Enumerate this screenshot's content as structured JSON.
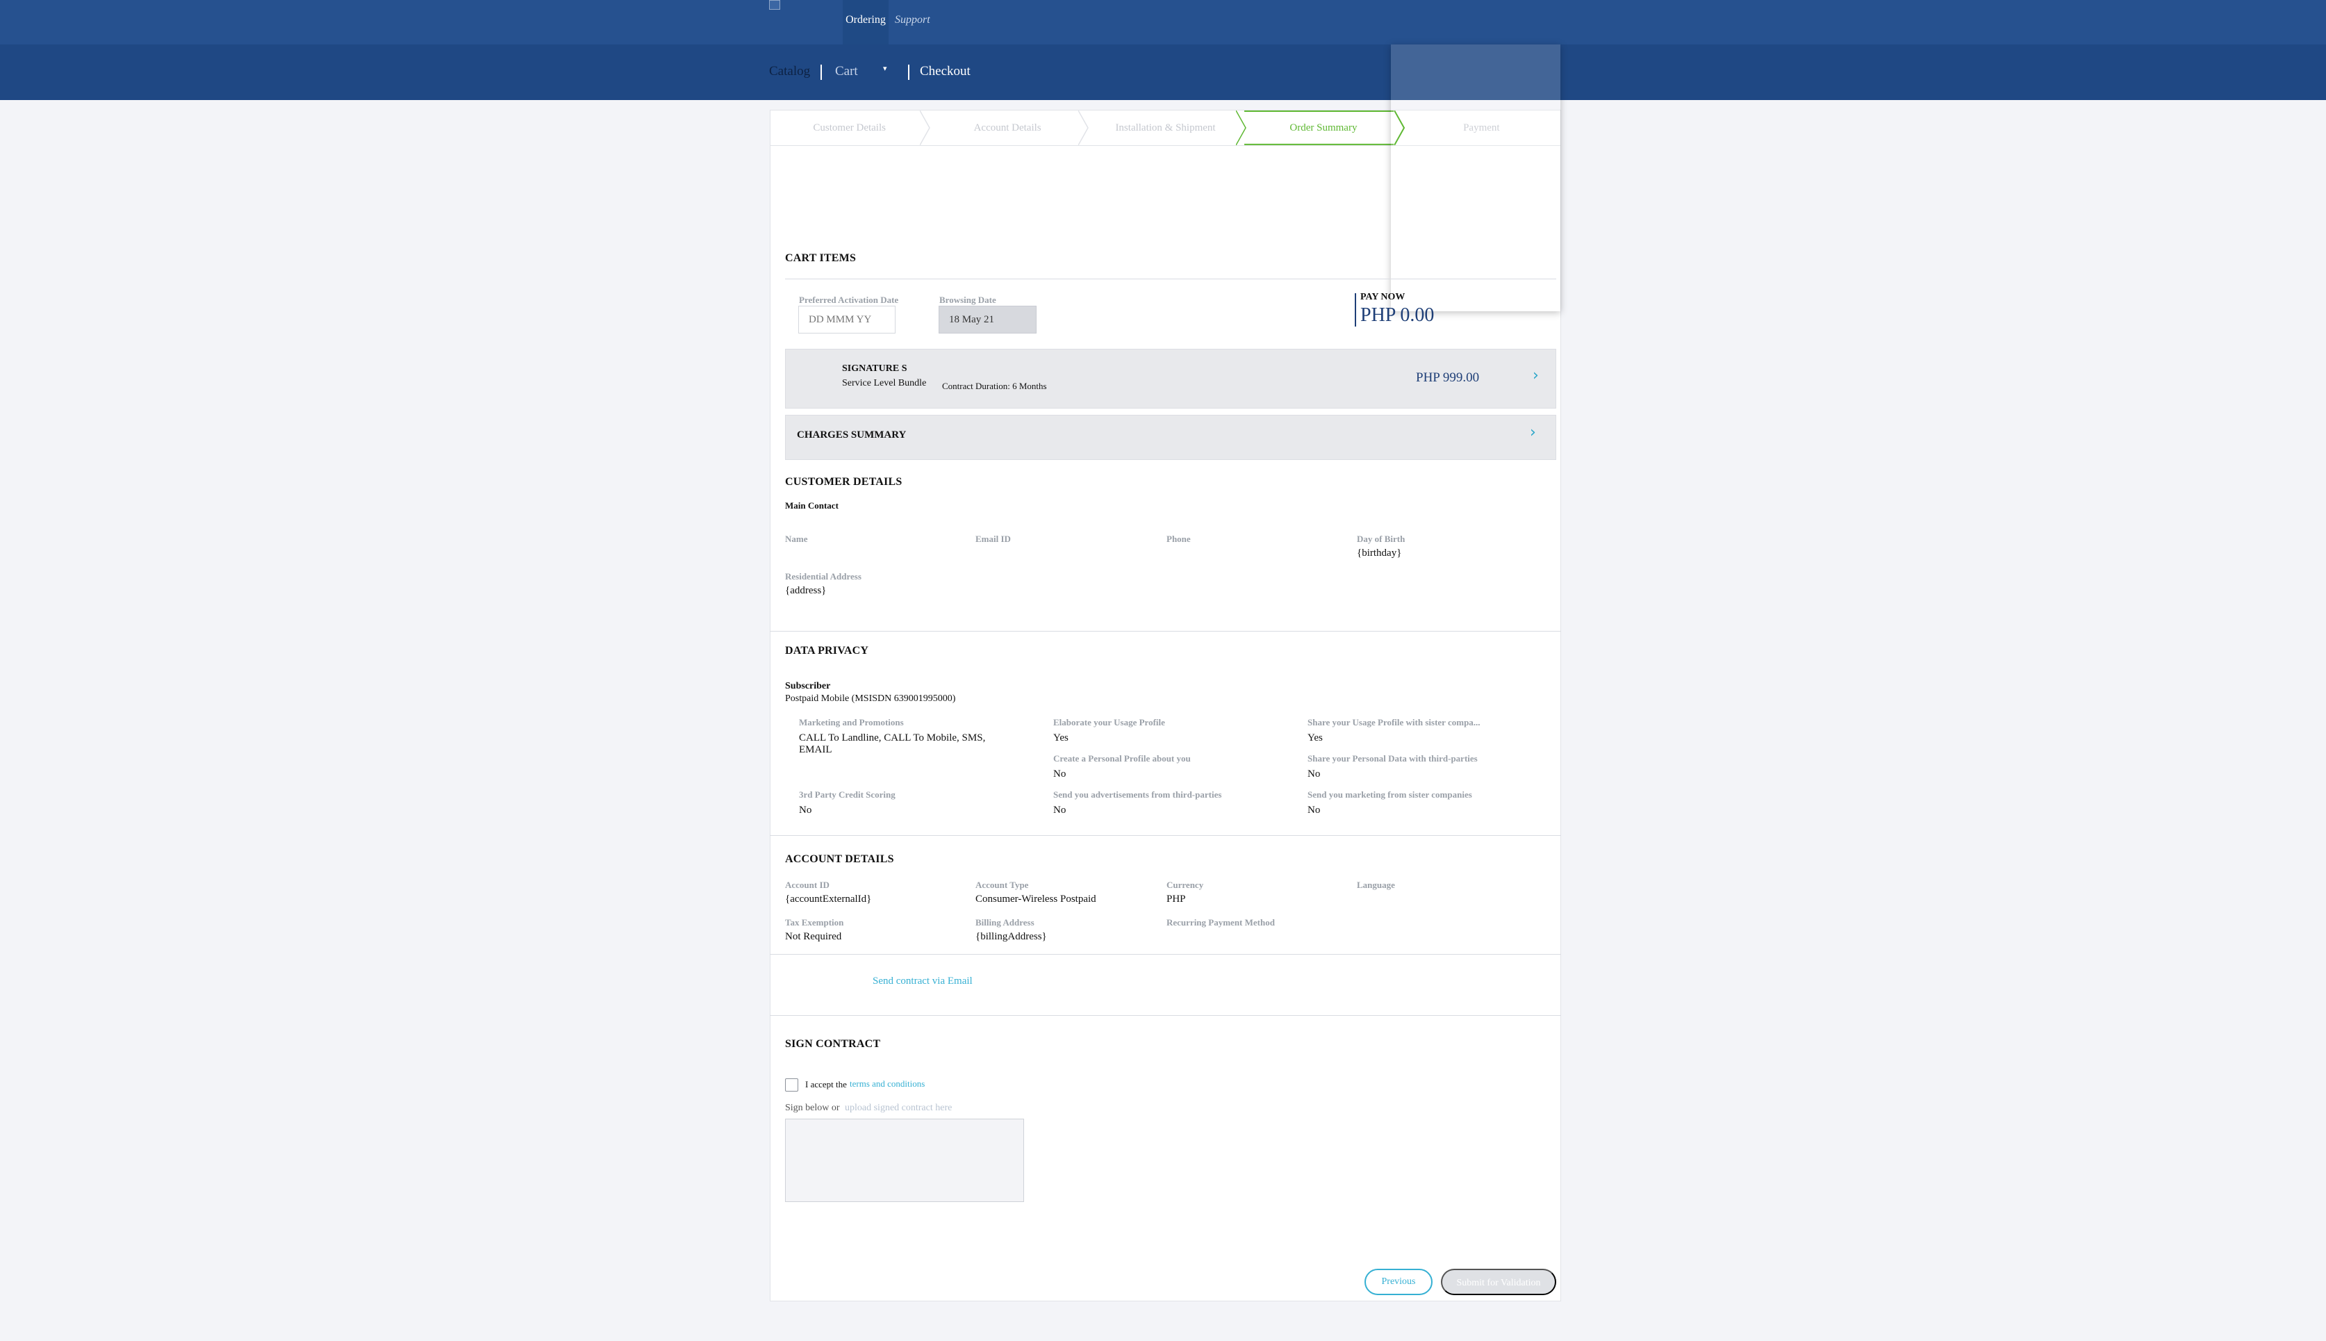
{
  "topnav": {
    "ordering": "Ordering",
    "support": "Support"
  },
  "subnav": {
    "catalog": "Catalog",
    "cart": "Cart",
    "cart_caret": "▾",
    "checkout": "Checkout"
  },
  "steps": [
    "Customer Details",
    "Account Details",
    "Installation & Shipment",
    "Order Summary",
    "Payment"
  ],
  "active_step": "Order Summary",
  "colors": {
    "header": "#26518f",
    "subheader": "#1f4884",
    "active_step": "#5fb833",
    "link": "#36b0d3",
    "price": "#1f3f77"
  },
  "cart": {
    "title": "CART ITEMS",
    "preferred_activation_label": "Preferred Activation Date",
    "preferred_activation_placeholder": "DD MMM YY",
    "browsing_date_label": "Browsing Date",
    "browsing_date_value": "18 May 21",
    "pay_now_label": "PAY NOW",
    "pay_now_value": "PHP 0.00",
    "bundle_name": "SIGNATURE S",
    "bundle_type": "Service Level Bundle",
    "contract_duration": "Contract Duration: 6 Months",
    "bundle_price": "PHP 999.00",
    "charges_summary": "CHARGES SUMMARY",
    "chevron_icon": "chevron-right-icon"
  },
  "customer": {
    "title": "CUSTOMER DETAILS",
    "main_contact": "Main Contact",
    "name_label": "Name",
    "email_label": "Email ID",
    "phone_label": "Phone",
    "dob_label": "Day of Birth",
    "dob_value": "{birthday}",
    "address_label": "Residential Address",
    "address_value": "{address}"
  },
  "privacy": {
    "title": "DATA PRIVACY",
    "subscriber_label": "Subscriber",
    "subscriber_value": "Postpaid Mobile (MSISDN 639001995000)",
    "marketing_label": "Marketing and Promotions",
    "marketing_value_1": "CALL To Landline, CALL To Mobile, SMS,",
    "marketing_value_2": "EMAIL",
    "elaborate_label": "Elaborate your Usage Profile",
    "elaborate_value": "Yes",
    "share_usage_label": "Share your Usage Profile with sister compa...",
    "share_usage_value": "Yes",
    "personal_profile_label": "Create a Personal Profile about you",
    "personal_profile_value": "No",
    "share_personal_label": "Share your Personal Data with third-parties",
    "share_personal_value": "No",
    "credit_label": "3rd Party Credit Scoring",
    "credit_value": "No",
    "ads_label": "Send you advertisements from third-parties",
    "ads_value": "No",
    "sister_label": "Send you marketing from sister companies",
    "sister_value": "No"
  },
  "account": {
    "title": "ACCOUNT DETAILS",
    "id_label": "Account ID",
    "id_value": "{accountExternalId}",
    "type_label": "Account Type",
    "type_value": "Consumer-Wireless Postpaid",
    "currency_label": "Currency",
    "currency_value": "PHP",
    "language_label": "Language",
    "tax_label": "Tax Exemption",
    "tax_value": "Not Required",
    "billing_label": "Billing Address",
    "billing_value": "{billingAddress}",
    "recurring_label": "Recurring Payment Method"
  },
  "send_contract": "Send contract via Email",
  "sign": {
    "title": "SIGN CONTRACT",
    "accept_text": "I accept the",
    "terms_link": "terms and conditions",
    "sign_below": "Sign below or",
    "upload_link": "upload signed contract here"
  },
  "buttons": {
    "previous": "Previous",
    "submit": "Submit for Validation"
  }
}
